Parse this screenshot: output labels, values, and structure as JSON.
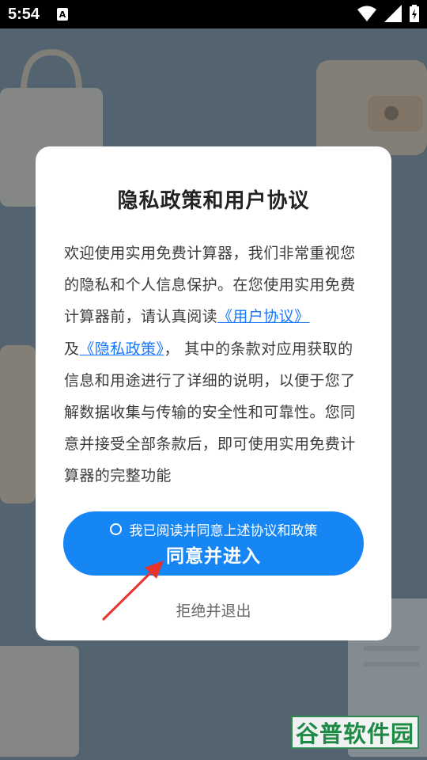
{
  "status_bar": {
    "time": "5:54",
    "notification_icon": "A"
  },
  "dialog": {
    "title": "隐私政策和用户协议",
    "body": {
      "part1": "欢迎使用实用免费计算器，我们非常重视您的隐私和个人信息保护。在您使用实用免费计算器前，请认真阅读",
      "link_user_agreement": "《用户协议》",
      "part2": "及",
      "link_privacy_policy": "《隐私政策》",
      "part3": "， 其中的条款对应用获取的信息和用途进行了详细的说明，以便于您了解数据收集与传输的安全性和可靠性。您同意并接受全部条款后，即可使用实用免费计算器的完整功能"
    },
    "agree_checkbox_label": "我已阅读并同意上述协议和政策",
    "agree_button_label": "同意并进入",
    "refuse_label": "拒绝并退出"
  },
  "watermark": "谷普软件园",
  "colors": {
    "accent": "#1786f5",
    "link": "#1677ff",
    "arrow": "#e8322c"
  }
}
